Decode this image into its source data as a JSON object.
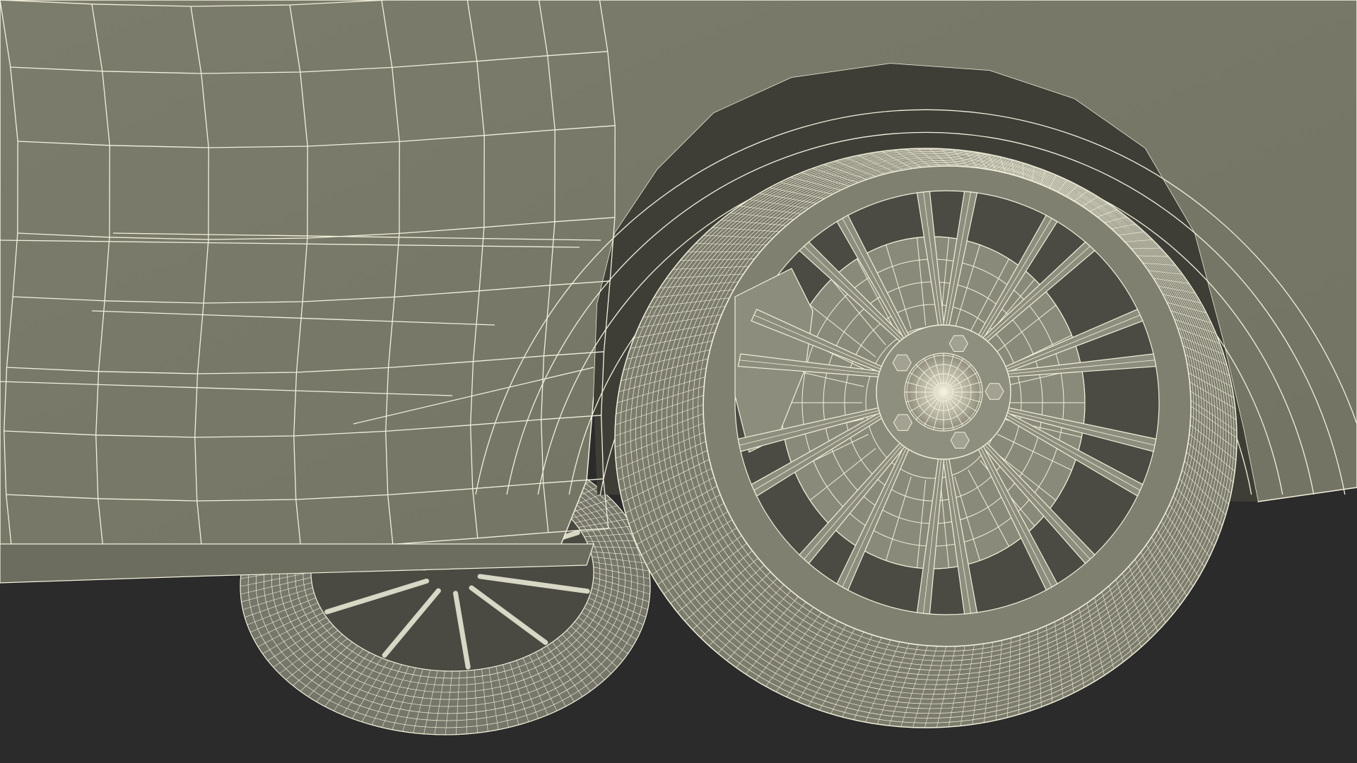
{
  "scene": {
    "background_color": "#2b2b2b",
    "body_color": "#7f7f6f",
    "body_shadow_color": "#5f5f52",
    "wireframe_color": "#f3f0dc",
    "wheel_well_color": "#3a3a35",
    "hub_color": "#d8d5c2"
  }
}
